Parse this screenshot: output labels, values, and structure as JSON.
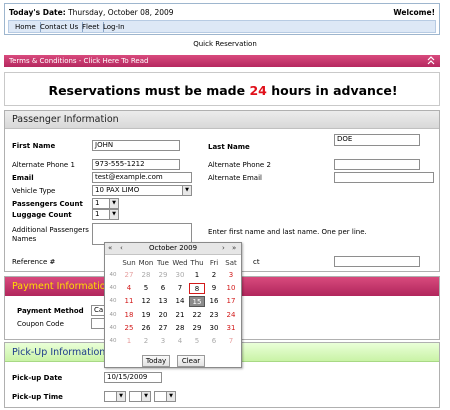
{
  "header": {
    "date_label": "Today's Date:",
    "date_value": "Thursday, October 08, 2009",
    "welcome": "Welcome!",
    "nav": [
      "Home",
      "Contact Us",
      "Fleet",
      "Log-In"
    ]
  },
  "page_title": "Quick Reservation",
  "terms_bar": {
    "label": "Terms & Conditions - Click Here To Read",
    "icon": "chevron-up-icon"
  },
  "notice": {
    "prefix": "Reservations must be made ",
    "hours": "24",
    "suffix": " hours in advance!"
  },
  "passenger": {
    "title": "Passenger Information",
    "first_name_label": "First Name",
    "first_name_value": "JOHN",
    "last_name_label": "Last Name",
    "last_name_value": "DOE",
    "alt_phone1_label": "Alternate Phone 1",
    "alt_phone1_value": "973-555-1212",
    "alt_phone2_label": "Alternate Phone 2",
    "alt_phone2_value": "",
    "email_label": "Email",
    "email_value": "test@example.com",
    "alt_email_label": "Alternate Email",
    "alt_email_value": "",
    "vehicle_label": "Vehicle Type",
    "vehicle_value": "10 PAX LIMO",
    "pcount_label": "Passengers Count",
    "pcount_value": "1",
    "lcount_label": "Luggage Count",
    "lcount_value": "1",
    "additional_label": "Additional Passengers Names",
    "additional_hint": "Enter first name and last name. One per line.",
    "ref_label": "Reference #",
    "ct_label": "ct"
  },
  "payment": {
    "title": "Payment Information",
    "method_label": "Payment Method",
    "method_value": "Ca",
    "coupon_label": "Coupon Code"
  },
  "pickup": {
    "title": "Pick-Up Information",
    "date_label": "Pick-up Date",
    "date_value": "10/15/2009",
    "time_label": "Pick-up Time"
  },
  "calendar": {
    "nav_prev_year": "«",
    "nav_prev_month": "‹",
    "nav_next_month": "›",
    "nav_next_year": "»",
    "month_title": "October 2009",
    "days": [
      "Sun",
      "Mon",
      "Tue",
      "Wed",
      "Thu",
      "Fri",
      "Sat"
    ],
    "week_marker": "40",
    "weeks": [
      [
        "27",
        "28",
        "29",
        "30",
        "1",
        "2",
        "3"
      ],
      [
        "4",
        "5",
        "6",
        "7",
        "8",
        "9",
        "10"
      ],
      [
        "11",
        "12",
        "13",
        "14",
        "15",
        "16",
        "17"
      ],
      [
        "18",
        "19",
        "20",
        "21",
        "22",
        "23",
        "24"
      ],
      [
        "25",
        "26",
        "27",
        "28",
        "29",
        "30",
        "31"
      ],
      [
        "1",
        "2",
        "3",
        "4",
        "5",
        "6",
        "7"
      ]
    ],
    "today_button": "Today",
    "clear_button": "Clear"
  },
  "colors": {
    "accent_pink": "#c2336a",
    "red": "#e0101a",
    "payment_title": "#ffde00",
    "pickup_title": "#1d3b8a"
  }
}
